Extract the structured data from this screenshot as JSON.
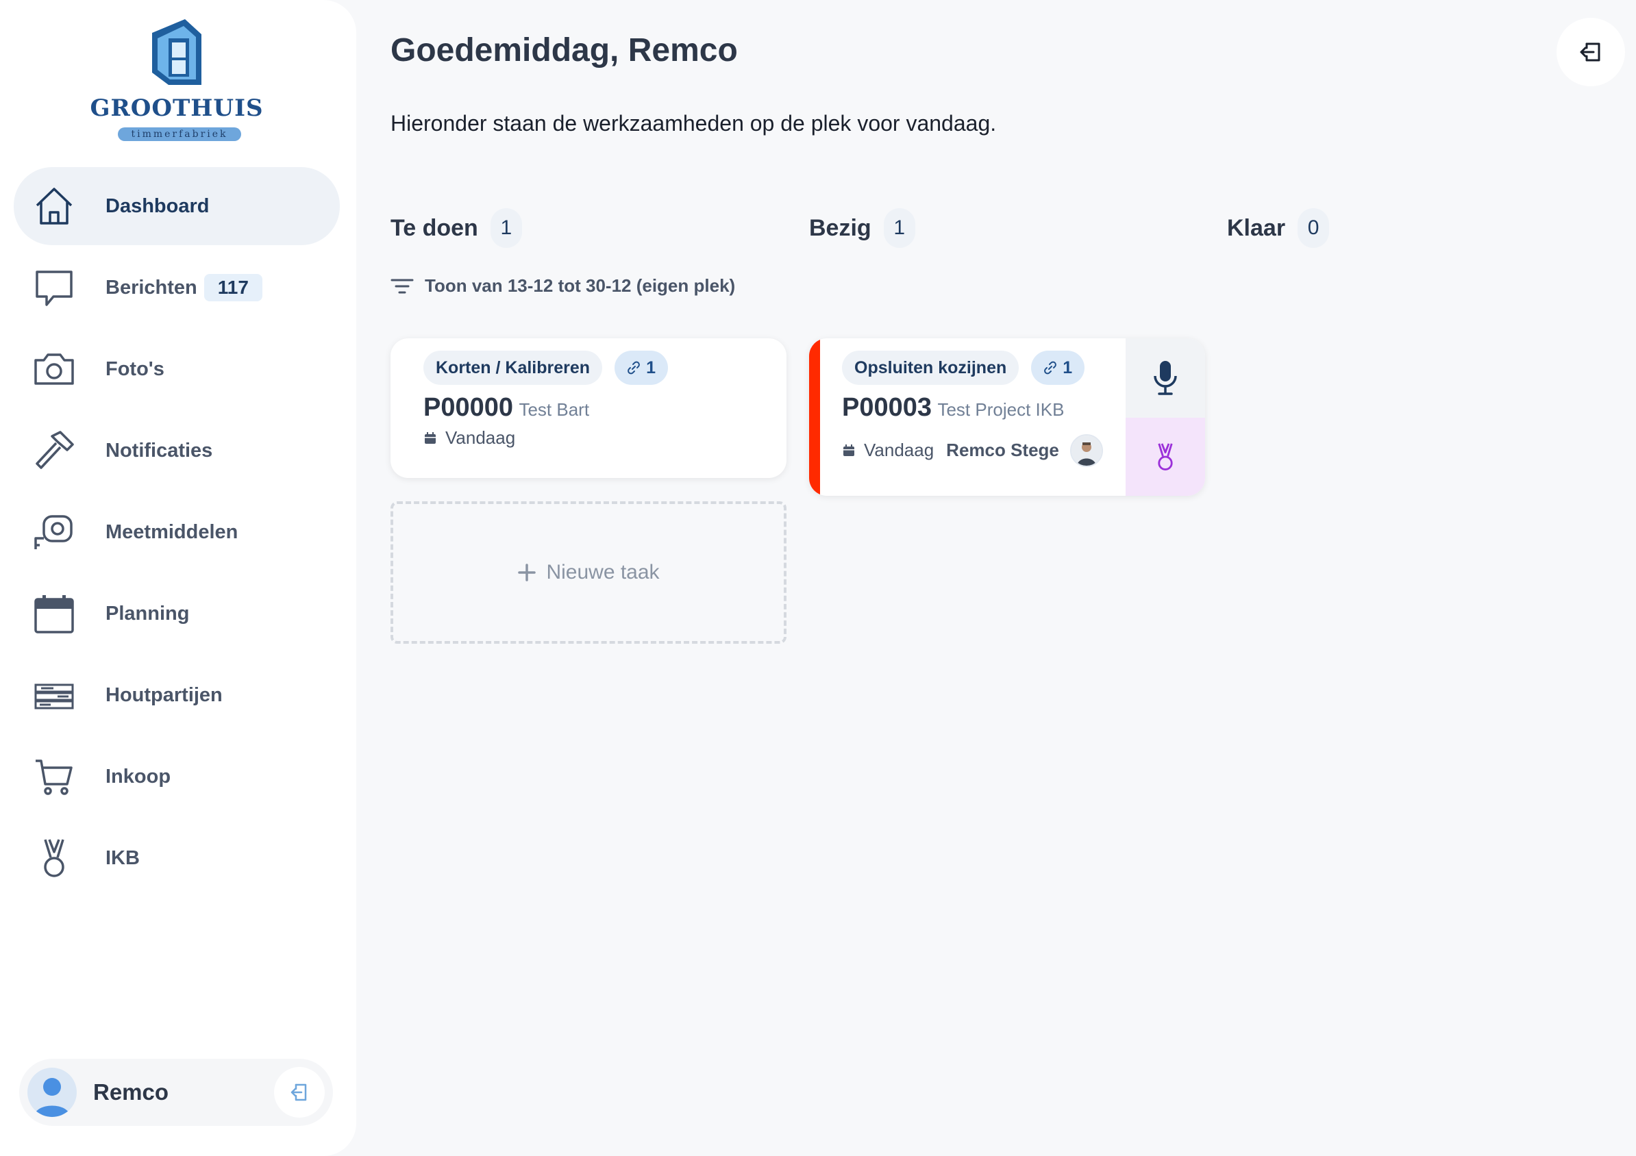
{
  "brand": {
    "name": "GROOTHUIS",
    "tagline": "timmerfabriek"
  },
  "sidebar": {
    "items": [
      {
        "label": "Dashboard",
        "icon": "home-icon",
        "active": true
      },
      {
        "label": "Berichten",
        "icon": "chat-icon",
        "badge": "117"
      },
      {
        "label": "Foto's",
        "icon": "camera-icon"
      },
      {
        "label": "Notificaties",
        "icon": "hammer-icon"
      },
      {
        "label": "Meetmiddelen",
        "icon": "tape-measure-icon"
      },
      {
        "label": "Planning",
        "icon": "calendar-icon"
      },
      {
        "label": "Houtpartijen",
        "icon": "wood-stack-icon"
      },
      {
        "label": "Inkoop",
        "icon": "cart-icon"
      },
      {
        "label": "IKB",
        "icon": "medal-icon"
      }
    ],
    "user": {
      "name": "Remco"
    }
  },
  "main": {
    "greeting": "Goedemiddag, Remco",
    "subtitle": "Hieronder staan de werkzaamheden op de plek voor vandaag.",
    "filter": "Toon van 13-12 tot 30-12 (eigen plek)",
    "columns": [
      {
        "title": "Te doen",
        "count": "1"
      },
      {
        "title": "Bezig",
        "count": "1"
      },
      {
        "title": "Klaar",
        "count": "0"
      }
    ],
    "cards": [
      {
        "tag": "Korten / Kalibreren",
        "links": "1",
        "code": "P00000",
        "project": "Test Bart",
        "date": "Vandaag"
      },
      {
        "tag": "Opsluiten kozijnen",
        "links": "1",
        "code": "P00003",
        "project": "Test Project IKB",
        "date": "Vandaag",
        "assignee": "Remco Stege"
      }
    ],
    "new_task": "Nieuwe taak"
  },
  "colors": {
    "primary": "#1e3a5f",
    "urgent": "#ff2a00",
    "ikb": "#9b30d9",
    "background": "#f7f8fa"
  }
}
